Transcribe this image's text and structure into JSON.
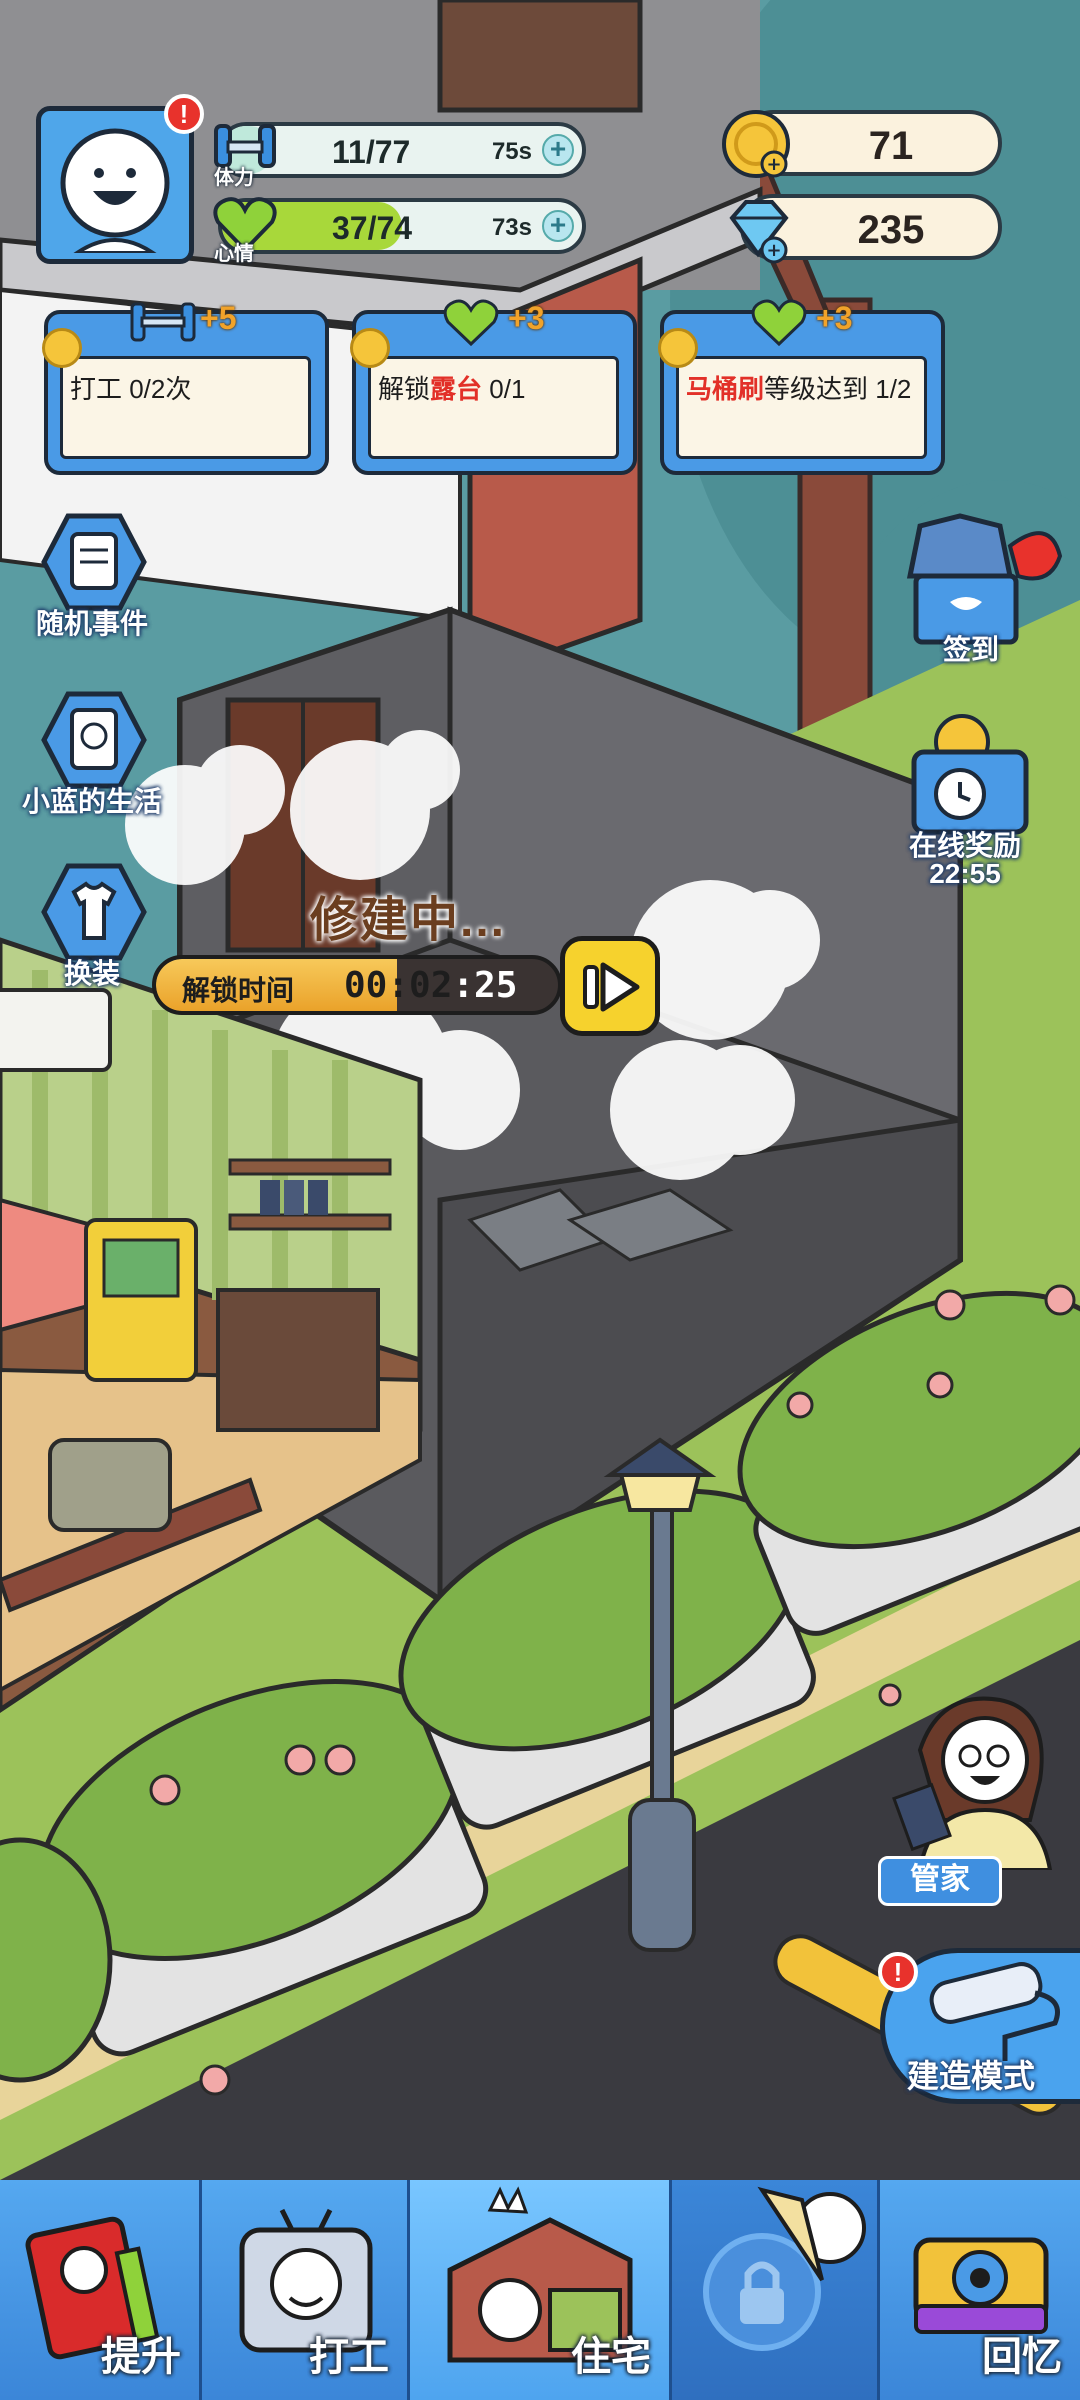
{
  "profile": {
    "alert": "!"
  },
  "stats": {
    "stamina": {
      "label": "体力",
      "value": "11/77",
      "timer": "75s",
      "fill": 0.143
    },
    "mood": {
      "label": "心情",
      "value": "37/74",
      "timer": "73s",
      "fill": 0.5
    }
  },
  "currency": {
    "coins": "71",
    "gems": "235"
  },
  "tasks": [
    {
      "reward": "+5",
      "icon": "dumbbell-icon",
      "text": "打工 0/2次"
    },
    {
      "reward": "+3",
      "icon": "heart-icon",
      "text_before": "解锁",
      "text_highlight": "露台",
      "text_after": " 0/1"
    },
    {
      "reward": "+3",
      "icon": "heart-icon",
      "text_highlight": "马桶刷",
      "text_after": "等级达到 1/2"
    }
  ],
  "left_menu": {
    "random_event": "随机事件",
    "xiaolan_life": "小蓝的生活",
    "dress_up": "换装"
  },
  "right_menu": {
    "sign_in": "签到",
    "online_reward": "在线奖励",
    "online_timer": "22:55",
    "butler": "管家",
    "build_mode": "建造模式",
    "build_mode_alert": "!"
  },
  "construction": {
    "status": "修建中...",
    "unlock_label": "解锁时间",
    "time_main": "00:02",
    "time_sec": ":25",
    "progress": 0.6
  },
  "bottom_nav": [
    {
      "label": "提升",
      "icon": "book-icon"
    },
    {
      "label": "打工",
      "icon": "work-icon"
    },
    {
      "label": "住宅",
      "icon": "house-icon"
    },
    {
      "label": "",
      "icon": "lock-icon"
    },
    {
      "label": "回忆",
      "icon": "camera-icon"
    }
  ],
  "colors": {
    "accent_blue": "#4a9ae6",
    "highlight_red": "#e23028",
    "coin": "#f5c53a",
    "grass": "#7fb24a"
  }
}
